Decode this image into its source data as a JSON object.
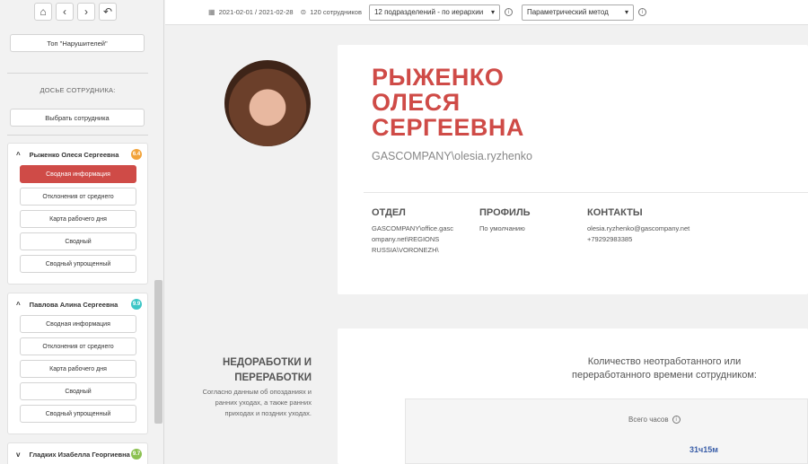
{
  "sidebar": {
    "top_button": "Топ \"Нарушителей\"",
    "dossier_label": "ДОСЬЕ СОТРУДНИКА:",
    "select_employee": "Выбрать сотрудника",
    "employees": [
      {
        "name": "Рыженко Олеся Сергеевна",
        "score": "6.4",
        "badge_color": "#f2a33a",
        "items": [
          "Сводная информация",
          "Отклонения от среднего",
          "Карта рабочего дня",
          "Сводный",
          "Сводный упрощенный"
        ]
      },
      {
        "name": "Павлова Алина Сергеевна",
        "score": "9.9",
        "badge_color": "#3ec6c6",
        "items": [
          "Сводная информация",
          "Отклонения от среднего",
          "Карта рабочего дня",
          "Сводный",
          "Сводный упрощенный"
        ]
      },
      {
        "name": "Гладких Изабелла Георгиевна",
        "score": "9.7",
        "badge_color": "#8cc152"
      }
    ]
  },
  "topbar": {
    "date_range": "2021-02-01 / 2021-02-28",
    "employee_count": "120 сотрудников",
    "departments_select": "12 подразделений - по иерархии",
    "method_select": "Параметрический метод"
  },
  "profile": {
    "name_lines": [
      "РЫЖЕНКО",
      "ОЛЕСЯ",
      "СЕРГЕЕВНА"
    ],
    "login": "GASCOMPANY\\olesia.ryzhenko",
    "dept_heading": "ОТДЕЛ",
    "dept_lines": [
      "GASCOMPANY\\office.gasc",
      "ompany.net\\REGIONS",
      "RUSSIA\\VORONEZH\\"
    ],
    "profile_heading": "ПРОФИЛЬ",
    "profile_value": "По умолчанию",
    "contacts_heading": "КОНТАКТЫ",
    "email": "olesia.ryzhenko@gascompany.net",
    "phone": "+79292983385"
  },
  "section": {
    "title_lines": [
      "НЕДОРАБОТКИ И",
      "ПЕРЕРАБОТКИ"
    ],
    "desc_lines": [
      "Согласно данным об опозданиях и",
      "ранних уходах, а также ранних",
      "приходах и поздних уходах."
    ],
    "chart_title_lines": [
      "Количество неотработанного или",
      "переработанного времени сотрудником:"
    ],
    "chart_subtitle": "Всего часов",
    "chart_value_label": "31ч15м"
  }
}
